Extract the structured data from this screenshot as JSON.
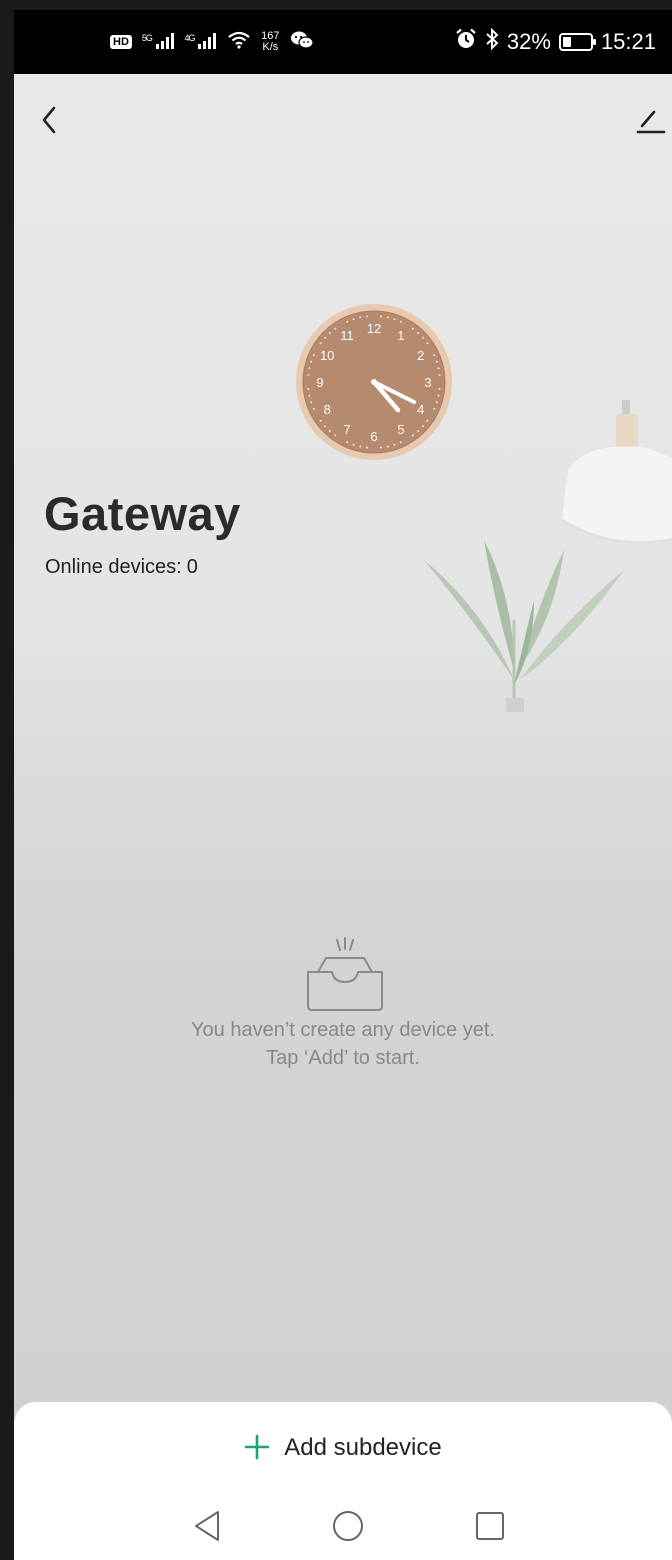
{
  "status_bar": {
    "hd_badge": "HD",
    "sim1": "5G",
    "sim2": "4G",
    "speed_value": "167",
    "speed_unit": "K/s",
    "battery_percent": "32%",
    "battery_level": 0.32,
    "time": "15:21",
    "icons": [
      "hd-icon",
      "signal-5g-icon",
      "signal-4g-icon",
      "wifi-icon",
      "wechat-icon",
      "alarm-icon",
      "bluetooth-icon",
      "battery-icon"
    ]
  },
  "header": {
    "back_icon": "chevron-left-icon",
    "edit_icon": "pencil-icon"
  },
  "gateway": {
    "title": "Gateway",
    "online_label": "Online devices:",
    "online_count": "0"
  },
  "empty_state": {
    "icon": "empty-inbox-icon",
    "line1": "You haven’t create any device yet.",
    "line2": "Tap ‘Add’ to start."
  },
  "bottom_sheet": {
    "add_label": "Add subdevice",
    "add_icon": "plus-icon",
    "accent_color": "#1aa37a"
  },
  "nav_bar": {
    "buttons": [
      "back-triangle-icon",
      "home-circle-icon",
      "recents-square-icon"
    ]
  },
  "background": {
    "clock_numerals": [
      "12",
      "1",
      "2",
      "3",
      "4",
      "5",
      "6",
      "7",
      "8",
      "9",
      "10",
      "11"
    ]
  }
}
